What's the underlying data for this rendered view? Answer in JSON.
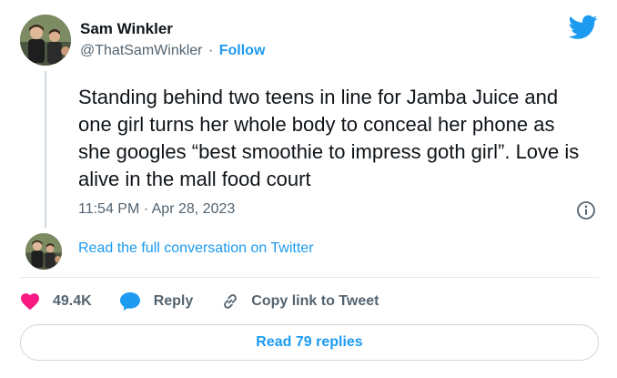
{
  "author": {
    "name": "Sam Winkler",
    "handle": "@ThatSamWinkler",
    "separator": "·",
    "follow_label": "Follow"
  },
  "tweet": {
    "text": "Standing behind two teens in line for Jamba Juice and one girl turns her whole body to conceal her phone as she googles “best smoothie to impress goth girl”. Love is alive in the mall food court",
    "timestamp": "11:54 PM · Apr 28, 2023"
  },
  "conversation": {
    "read_full_label": "Read the full conversation on Twitter"
  },
  "actions": {
    "like_count": "49.4K",
    "reply_label": "Reply",
    "copy_link_label": "Copy link to Tweet"
  },
  "footer": {
    "read_replies_label": "Read 79 replies"
  },
  "icons": {
    "brand": "twitter-bird-icon",
    "info": "info-icon",
    "like": "heart-icon",
    "reply": "speech-bubble-icon",
    "copy": "link-icon"
  },
  "colors": {
    "accent": "#1d9bf0",
    "heart": "#f91880",
    "secondary_text": "#536471",
    "primary_text": "#0f1419"
  }
}
